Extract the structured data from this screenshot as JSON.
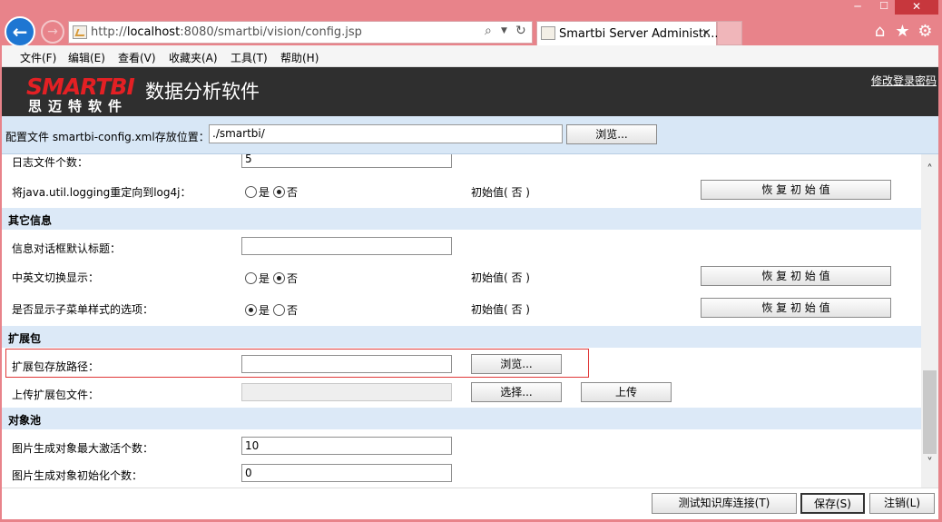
{
  "window": {
    "minimize": "─",
    "maximize": "☐",
    "close": "✕"
  },
  "browser": {
    "back": "←",
    "forward": "→",
    "url_prefix": "http://",
    "url_host": "localhost",
    "url_rest": ":8080/smartbi/vision/config.jsp",
    "search_icon": "⌕",
    "dropdown_icon": "▼",
    "refresh_icon": "↻",
    "tab_title": "Smartbi Server Administr...",
    "tab_close": "×",
    "home_icon": "⌂",
    "favorites_icon": "★",
    "settings_icon": "⚙"
  },
  "menu": [
    "文件(F)",
    "编辑(E)",
    "查看(V)",
    "收藏夹(A)",
    "工具(T)",
    "帮助(H)"
  ],
  "header": {
    "logo_main": "SMARTBI",
    "logo_sub": "思迈特软件",
    "product_name": "数据分析软件",
    "change_password": "修改登录密码"
  },
  "config_bar": {
    "label": "配置文件 smartbi-config.xml存放位置：",
    "path_value": "./smartbi/",
    "browse_label": "浏览..."
  },
  "rows": {
    "log_file_count": {
      "label": "日志文件个数：",
      "value": "5"
    },
    "redirect_logging": {
      "label": "将java.util.logging重定向到log4j：",
      "yes": "是",
      "no": "否",
      "default_text": "初始值( 否 )",
      "reset_label": "恢 复 初 始 值"
    }
  },
  "sections": {
    "other": {
      "title": "其它信息",
      "dialog_title": {
        "label": "信息对话框默认标题：",
        "value": ""
      },
      "lang_switch": {
        "label": "中英文切换显示：",
        "yes": "是",
        "no": "否",
        "default_text": "初始值( 否 )",
        "reset_label": "恢 复 初 始 值"
      },
      "submenu_style": {
        "label": "是否显示子菜单样式的选项：",
        "yes": "是",
        "no": "否",
        "default_text": "初始值( 否 )",
        "reset_label": "恢 复 初 始 值"
      }
    },
    "extension": {
      "title": "扩展包",
      "path": {
        "label": "扩展包存放路径：",
        "value": "",
        "browse_label": "浏览..."
      },
      "upload": {
        "label": "上传扩展包文件：",
        "choose_label": "选择...",
        "upload_label": "上传"
      }
    },
    "object_pool": {
      "title": "对象池",
      "max_active": {
        "label": "图片生成对象最大激活个数：",
        "value": "10"
      },
      "init_count": {
        "label": "图片生成对象初始化个数：",
        "value": "0"
      }
    }
  },
  "scrollbar": {
    "up": "˄",
    "down": "˅"
  },
  "footer": {
    "test_label": "测试知识库连接(T)",
    "save_label": "保存(S)",
    "logout_label": "注销(L)"
  }
}
